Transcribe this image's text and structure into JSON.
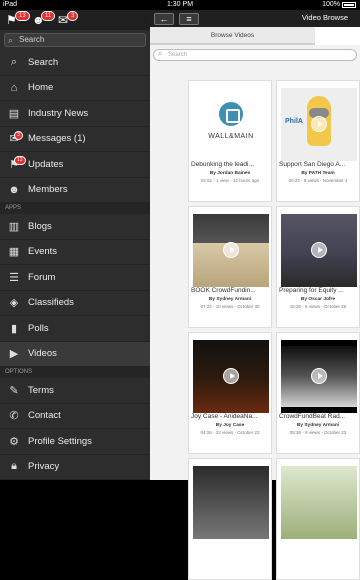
{
  "status": {
    "carrier": "iPad",
    "time": "1:30 PM",
    "battery": "100%"
  },
  "sidebar": {
    "badges": [
      {
        "icon": "flag-icon",
        "count": "13"
      },
      {
        "icon": "group-icon",
        "count": "11"
      },
      {
        "icon": "chat-icon",
        "count": "3"
      }
    ],
    "search_placeholder": "Search",
    "items": [
      {
        "label": "Search",
        "icon": "search-icon"
      },
      {
        "label": "Home",
        "icon": "home-icon"
      },
      {
        "label": "Industry News",
        "icon": "news-icon"
      },
      {
        "label": "Messages (1)",
        "icon": "mail-icon",
        "badge": "3"
      },
      {
        "label": "Updates",
        "icon": "flag-icon",
        "badge": "13"
      },
      {
        "label": "Members",
        "icon": "members-icon"
      }
    ],
    "section_apps": "APPS",
    "apps": [
      {
        "label": "Blogs",
        "icon": "book-icon"
      },
      {
        "label": "Events",
        "icon": "calendar-icon"
      },
      {
        "label": "Forum",
        "icon": "forum-icon"
      },
      {
        "label": "Classifieds",
        "icon": "tag-icon"
      },
      {
        "label": "Polls",
        "icon": "poll-icon"
      },
      {
        "label": "Videos",
        "icon": "video-icon",
        "active": true
      }
    ],
    "section_options": "OPTIONS",
    "options": [
      {
        "label": "Terms",
        "icon": "terms-icon"
      },
      {
        "label": "Contact",
        "icon": "phone-icon"
      },
      {
        "label": "Profile Settings",
        "icon": "gear-icon"
      },
      {
        "label": "Privacy",
        "icon": "lock-icon"
      }
    ]
  },
  "main": {
    "title": "Video Browse",
    "tab_browse": "Browse Videos",
    "search_placeholder": "Search",
    "videos": [
      {
        "title": "Debunking the leadi...",
        "by": "By Jordan Baines",
        "meta": "02:51 - 1 view - 12 hours ago",
        "thumb": "wallmain"
      },
      {
        "title": "Support San Diego A...",
        "by": "By PATH Team",
        "meta": "00:23 - 8 views - November 4",
        "thumb": "minion"
      },
      {
        "title": "BOOK CrowdFundin...",
        "by": "By Sydney Armani",
        "meta": "07:22 - 10 views - October 30",
        "thumb": "s1"
      },
      {
        "title": "Preparing for Equity ...",
        "by": "By Oscar Jofre",
        "meta": "15:30 - 8 views - October 26",
        "thumb": "s2"
      },
      {
        "title": "Joy Case - AnideaNa...",
        "by": "By Joy Case",
        "meta": "04:26 - 22 views - October 23",
        "thumb": "s3"
      },
      {
        "title": "CrowdFundBeat Rad...",
        "by": "By Sydney Armani",
        "meta": "05:36 - 9 views - October 23",
        "thumb": "s4"
      }
    ],
    "logo_wallmain": "WALL&MAIN",
    "logo_phil": "PhilA"
  }
}
